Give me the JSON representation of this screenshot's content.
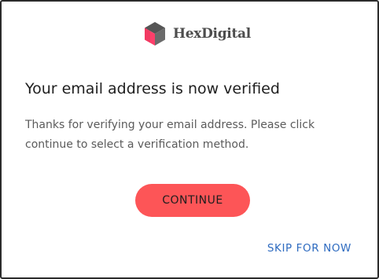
{
  "brand": {
    "name": "HexDigital",
    "logo_icon": "hexagon-cube-icon",
    "accent": "#fd5557",
    "dark": "#4d4d4d"
  },
  "dialog": {
    "title": "Your email address is now verified",
    "message": "Thanks for verifying your email address. Please click continue to select a verification method.",
    "continue_label": "CONTINUE",
    "skip_label": "SKIP FOR NOW"
  },
  "colors": {
    "button_bg": "#fd5557",
    "link": "#2e6bc0",
    "title_text": "#1f1f1f",
    "body_text": "#5b5b5b"
  }
}
